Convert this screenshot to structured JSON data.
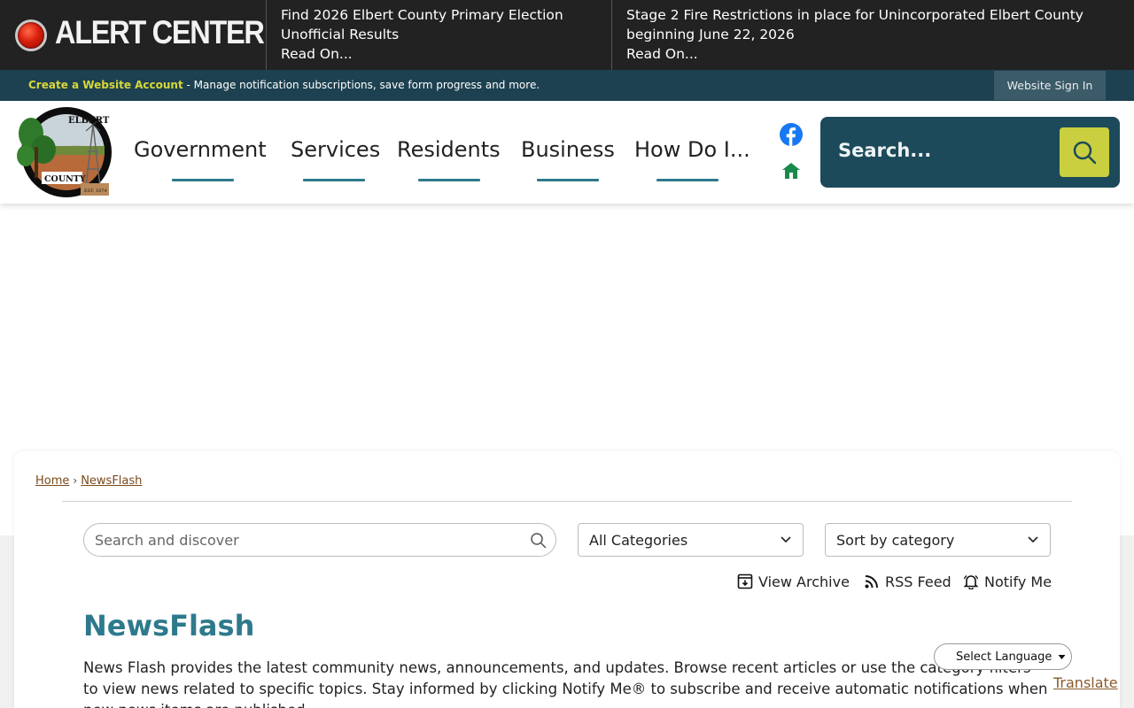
{
  "alert_bar": {
    "title": "ALERT CENTER",
    "items": [
      {
        "text": "Find 2026 Elbert County Primary Election Unofficial Results",
        "read_more": "Read On..."
      },
      {
        "text": "Stage 2 Fire Restrictions in place for Unincorporated Elbert County beginning June 22, 2026",
        "read_more": "Read On..."
      }
    ]
  },
  "account_bar": {
    "create_link": "Create a Website Account",
    "message": " - Manage notification subscriptions, save form progress and more.",
    "sign_in": "Website Sign In"
  },
  "header": {
    "logo": {
      "text_top": "ELBERT",
      "text_bottom": "COUNTY",
      "est": "EST. 1874"
    },
    "nav": [
      "Government",
      "Services",
      "Residents",
      "Business",
      "How Do I..."
    ],
    "social_icons": [
      "facebook-icon",
      "home-icon"
    ],
    "search": {
      "placeholder": "Search..."
    }
  },
  "breadcrumb": {
    "home": "Home",
    "separator": "›",
    "current": "NewsFlash"
  },
  "newsflash": {
    "search_placeholder": "Search and discover",
    "category_select": "All Categories",
    "sort_select": "Sort by category",
    "tools": {
      "archive": "View Archive",
      "rss": "RSS Feed",
      "notify": "Notify Me"
    },
    "heading": "NewsFlash",
    "description": "News Flash provides the latest community news, announcements, and updates. Browse recent articles or use the category filters to view news related to specific topics. Stay informed by clicking Notify Me® to subscribe and receive automatic notifications when new news items are published."
  },
  "translate": {
    "select_label": "Select Language",
    "link": "Translate"
  },
  "colors": {
    "alert_bg": "#222222",
    "account_bg": "#1d4150",
    "accent_teal": "#2e7a8c",
    "search_bg": "#1d4a5b",
    "search_button": "#c9cf3e",
    "link_brown": "#7a4a1a"
  }
}
